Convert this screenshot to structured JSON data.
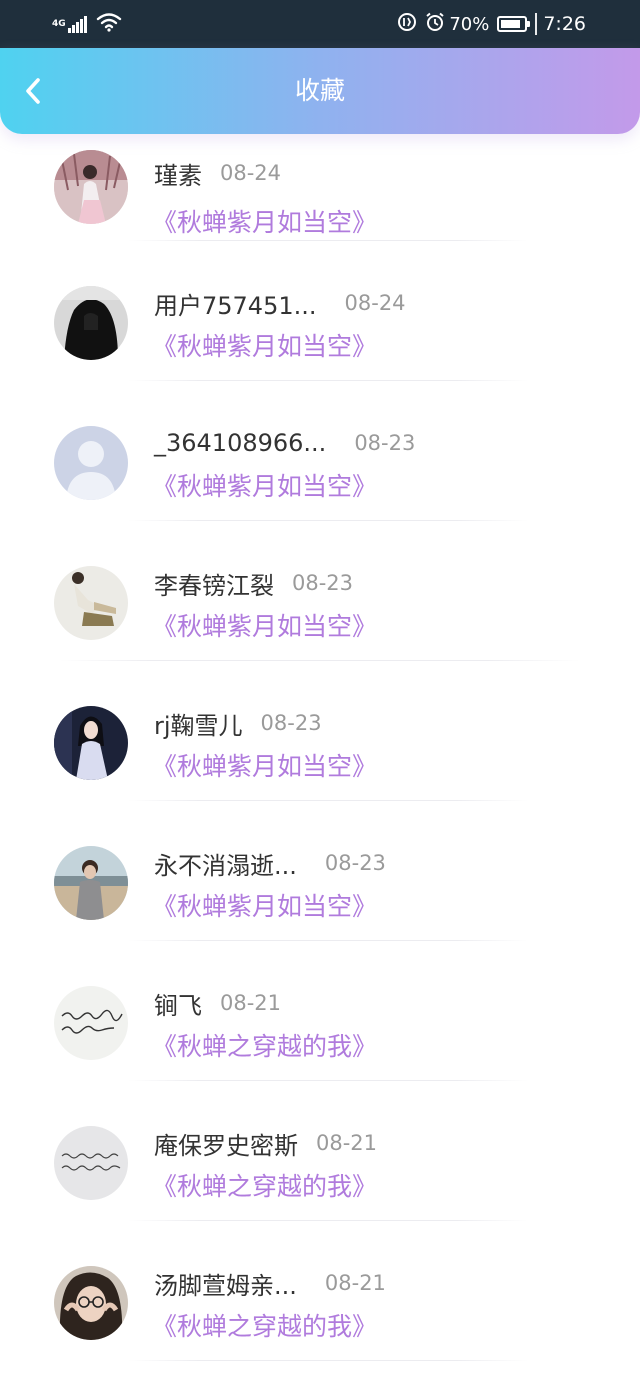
{
  "status_bar": {
    "network": "4G",
    "battery": "70%",
    "time": "7:26",
    "icons": [
      "signal-icon",
      "wifi-icon",
      "data-saver-icon",
      "alarm-icon",
      "battery-icon"
    ]
  },
  "header": {
    "title": "收藏",
    "back_icon": "chevron-left-icon"
  },
  "favorites": [
    {
      "name": "瑾素",
      "date": "08-24",
      "book": "《秋蝉紫月如当空》",
      "avatar": "girl-hanfu"
    },
    {
      "name": "用户757451...",
      "date": "08-24",
      "book": "《秋蝉紫月如当空》",
      "avatar": "dark-hood"
    },
    {
      "name": "_364108966...",
      "date": "08-23",
      "book": "《秋蝉紫月如当空》",
      "avatar": "default-user"
    },
    {
      "name": "李春镑江裂",
      "date": "08-23",
      "book": "《秋蝉紫月如当空》",
      "avatar": "girl-sitting"
    },
    {
      "name": "rj鞠雪儿",
      "date": "08-23",
      "book": "《秋蝉紫月如当空》",
      "avatar": "girl-portrait"
    },
    {
      "name": "永不消溻逝...",
      "date": "08-23",
      "book": "《秋蝉紫月如当空》",
      "avatar": "boy-beach"
    },
    {
      "name": "锏飞",
      "date": "08-21",
      "book": "《秋蝉之穿越的我》",
      "avatar": "calligraphy"
    },
    {
      "name": "庵保罗史密斯",
      "date": "08-21",
      "book": "《秋蝉之穿越的我》",
      "avatar": "calligraphy-gray"
    },
    {
      "name": "汤脚萱姆亲...",
      "date": "08-21",
      "book": "《秋蝉之穿越的我》",
      "avatar": "girl-glasses"
    }
  ],
  "colors": {
    "header_gradient_start": "#4fd2f0",
    "header_gradient_end": "#c39aea",
    "book_title": "#b07bdd",
    "name": "#333333",
    "date": "#9a9a9a"
  }
}
